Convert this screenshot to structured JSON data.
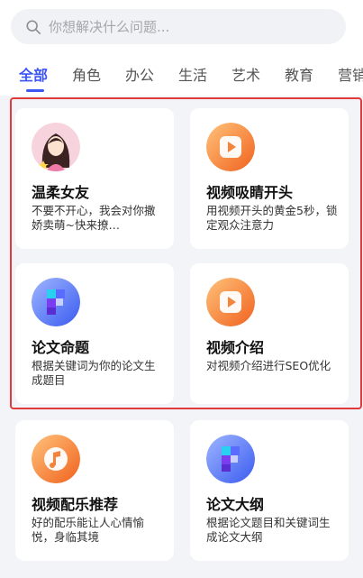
{
  "search": {
    "placeholder": "你想解决什么问题..."
  },
  "tabs": [
    "全部",
    "角色",
    "办公",
    "生活",
    "艺术",
    "教育",
    "营销"
  ],
  "cards": [
    {
      "title": "温柔女友",
      "desc": "不要不开心，我会对你撒娇卖萌~快来撩…",
      "icon": "girlfriend-avatar-icon"
    },
    {
      "title": "视频吸睛开头",
      "desc": "用视频开头的黄金5秒，锁定观众注意力",
      "icon": "video-play-icon"
    },
    {
      "title": "论文命题",
      "desc": "根据关键词为你的论文生成题目",
      "icon": "paper-blocks-icon"
    },
    {
      "title": "视频介绍",
      "desc": "对视频介绍进行SEO优化",
      "icon": "video-play-icon"
    },
    {
      "title": "视频配乐推荐",
      "desc": "好的配乐能让人心情愉悦，身临其境",
      "icon": "music-note-icon"
    },
    {
      "title": "论文大纲",
      "desc": "根据论文题目和关键词生成论文大纲",
      "icon": "paper-blocks-icon"
    }
  ],
  "colors": {
    "accent": "#3d55f5",
    "highlight": "#e23a3a",
    "icon_orange": "#f5843a",
    "icon_blue": "#4a6cf7"
  }
}
